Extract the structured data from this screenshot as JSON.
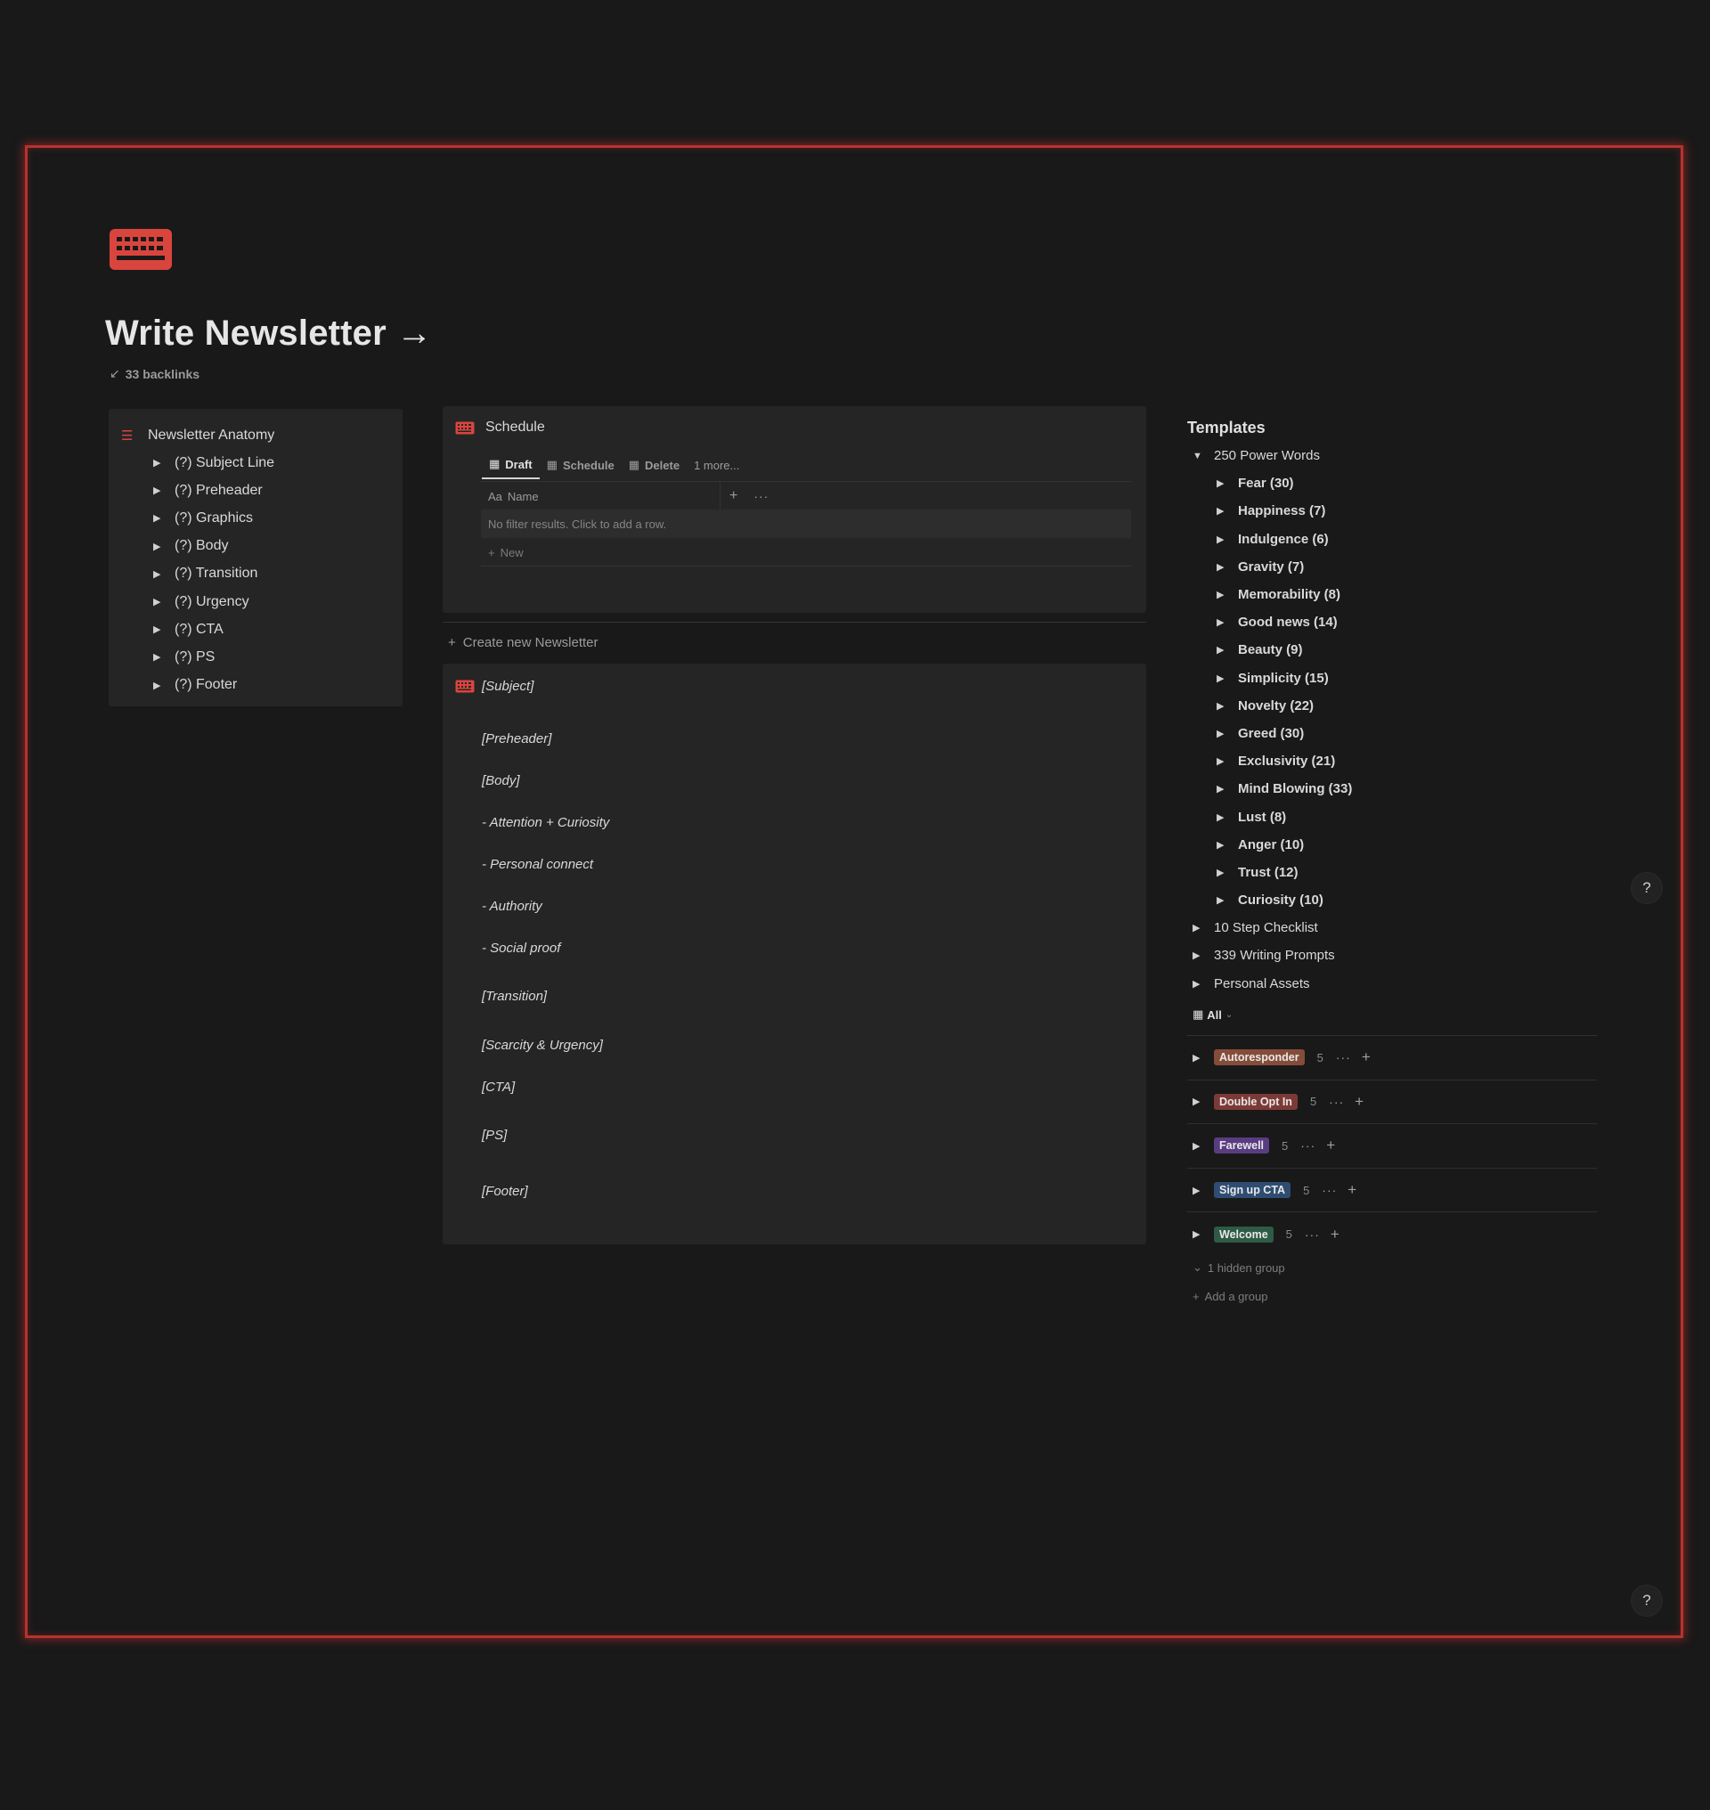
{
  "page": {
    "title": "Write Newsletter →",
    "backlinks_arrow": "↙",
    "backlinks": "33 backlinks"
  },
  "colors": {
    "accent": "#d9453d",
    "frame": "#b8322e",
    "background": "#191919",
    "panel": "#252525"
  },
  "anatomy": {
    "title": "Newsletter Anatomy",
    "items": [
      "(?) Subject Line",
      "(?) Preheader",
      "(?) Graphics",
      "(?) Body",
      "(?) Transition",
      "(?) Urgency",
      "(?) CTA",
      "(?) PS",
      "(?) Footer"
    ]
  },
  "schedule": {
    "title": "Schedule",
    "tabs": [
      "Draft",
      "Schedule",
      "Delete"
    ],
    "more": "1 more...",
    "name_column": "Name",
    "name_prefix": "Aa",
    "empty": "No filter results. Click to add a row.",
    "new": "New"
  },
  "create_new": "Create new Newsletter",
  "newsletter": {
    "subject": "[Subject]",
    "lines": [
      "[Preheader]",
      "[Body]",
      "- Attention + Curiosity",
      "- Personal connect",
      "- Authority",
      "- Social proof",
      "[Transition]",
      "[Scarcity & Urgency]",
      "[CTA]",
      "[PS]",
      "[Footer]"
    ]
  },
  "templates": {
    "title": "Templates",
    "power_words": "250 Power Words",
    "power_children": [
      "Fear (30)",
      "Happiness (7)",
      "Indulgence (6)",
      "Gravity (7)",
      "Memorability (8)",
      "Good news (14)",
      "Beauty (9)",
      "Simplicity (15)",
      "Novelty (22)",
      "Greed (30)",
      "Exclusivity (21)",
      "Mind Blowing (33)",
      "Lust (8)",
      "Anger (10)",
      "Trust (12)",
      "Curiosity (10)"
    ],
    "other": [
      "10 Step Checklist",
      "339 Writing Prompts",
      "Personal Assets"
    ]
  },
  "view": {
    "label": "All"
  },
  "groups": [
    {
      "label": "Autoresponder",
      "count": "5",
      "color": "#854c3a"
    },
    {
      "label": "Double Opt In",
      "count": "5",
      "color": "#7c3a37"
    },
    {
      "label": "Farewell",
      "count": "5",
      "color": "#5a3c82"
    },
    {
      "label": "Sign up CTA",
      "count": "5",
      "color": "#2f4d72"
    },
    {
      "label": "Welcome",
      "count": "5",
      "color": "#2e5b45"
    }
  ],
  "hidden_group": "1 hidden group",
  "add_group": "Add a group",
  "help": "?"
}
